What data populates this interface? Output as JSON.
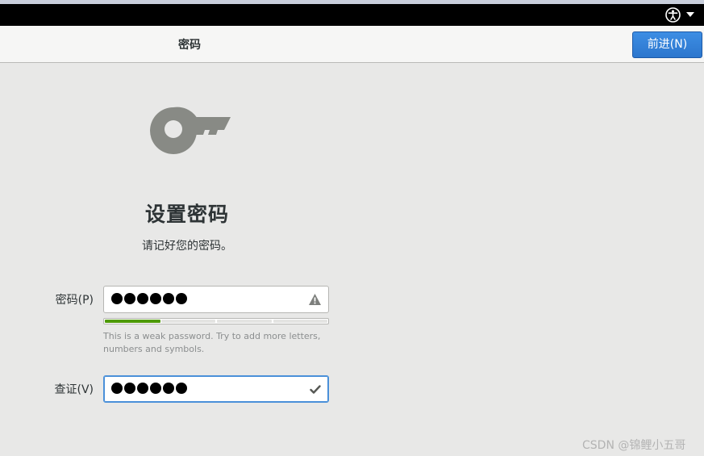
{
  "system_bar": {
    "accessibility_icon": "accessibility-icon",
    "menu_icon": "dropdown-arrow-icon"
  },
  "header": {
    "title": "密码",
    "next_button": "前进(N)"
  },
  "main": {
    "icon": "key-icon",
    "heading": "设置密码",
    "subtitle": "请记好您的密码。",
    "password": {
      "label": "密码(P)",
      "masked_length": 6,
      "status_icon": "warning-icon"
    },
    "strength": {
      "level_fraction": 0.25,
      "hint": "This is a weak password. Try to add more letters, numbers and symbols."
    },
    "confirm": {
      "label": "查证(V)",
      "masked_length": 6,
      "status_icon": "check-icon"
    }
  },
  "watermark": "CSDN @锦鲤小五哥",
  "colors": {
    "accent": "#3584e4",
    "strength_fill": "#4e9a06",
    "background": "#e8e8e7"
  }
}
